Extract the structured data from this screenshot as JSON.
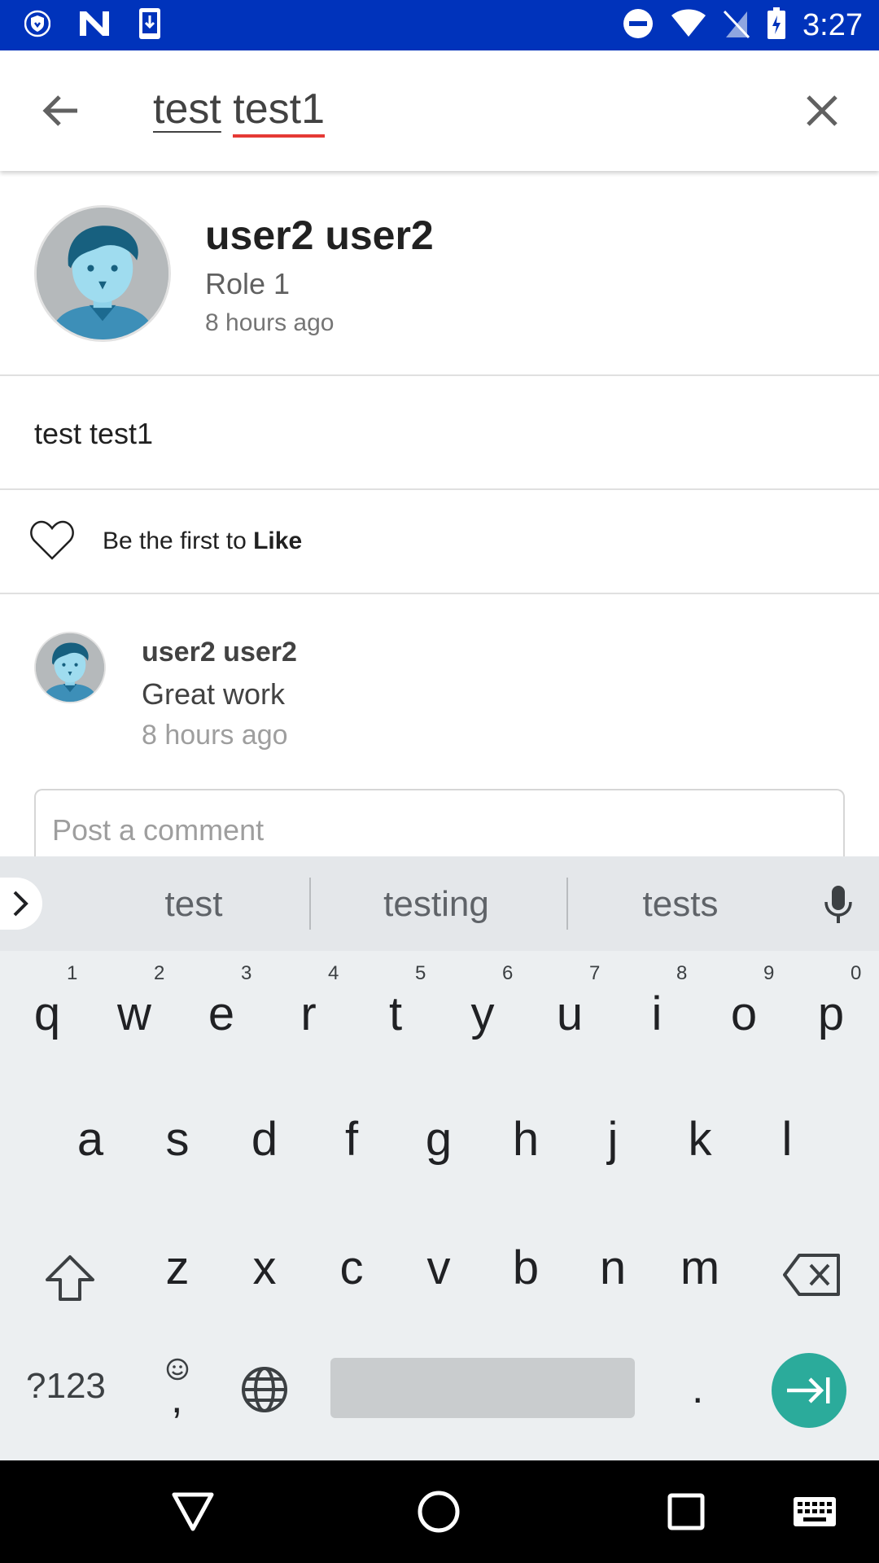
{
  "status_bar": {
    "time": "3:27",
    "icons": [
      "vpn-shield-icon",
      "n-app-icon",
      "download-icon",
      "dnd-icon",
      "wifi-icon",
      "no-sim-icon",
      "battery-charging-icon"
    ]
  },
  "search": {
    "word1": "test",
    "word2": "test1"
  },
  "post": {
    "author": "user2 user2",
    "role": "Role 1",
    "time": "8 hours ago",
    "body": "test test1",
    "like_prefix": "Be the first to ",
    "like_bold": "Like"
  },
  "comment": {
    "author": "user2 user2",
    "text": "Great work",
    "time": "8 hours ago"
  },
  "comment_input": {
    "placeholder": "Post a comment"
  },
  "keyboard": {
    "suggestions": [
      "test",
      "testing",
      "tests"
    ],
    "row1": [
      "q",
      "w",
      "e",
      "r",
      "t",
      "y",
      "u",
      "i",
      "o",
      "p"
    ],
    "row1_hints": [
      "1",
      "2",
      "3",
      "4",
      "5",
      "6",
      "7",
      "8",
      "9",
      "0"
    ],
    "row2": [
      "a",
      "s",
      "d",
      "f",
      "g",
      "h",
      "j",
      "k",
      "l"
    ],
    "row3": [
      "z",
      "x",
      "c",
      "v",
      "b",
      "n",
      "m"
    ],
    "symbols_label": "?123",
    "comma_label": ",",
    "period_label": ".",
    "accent_color": "#2bab9b"
  },
  "colors": {
    "status_bar": "#0033bb",
    "spell_underline": "#e53935"
  }
}
